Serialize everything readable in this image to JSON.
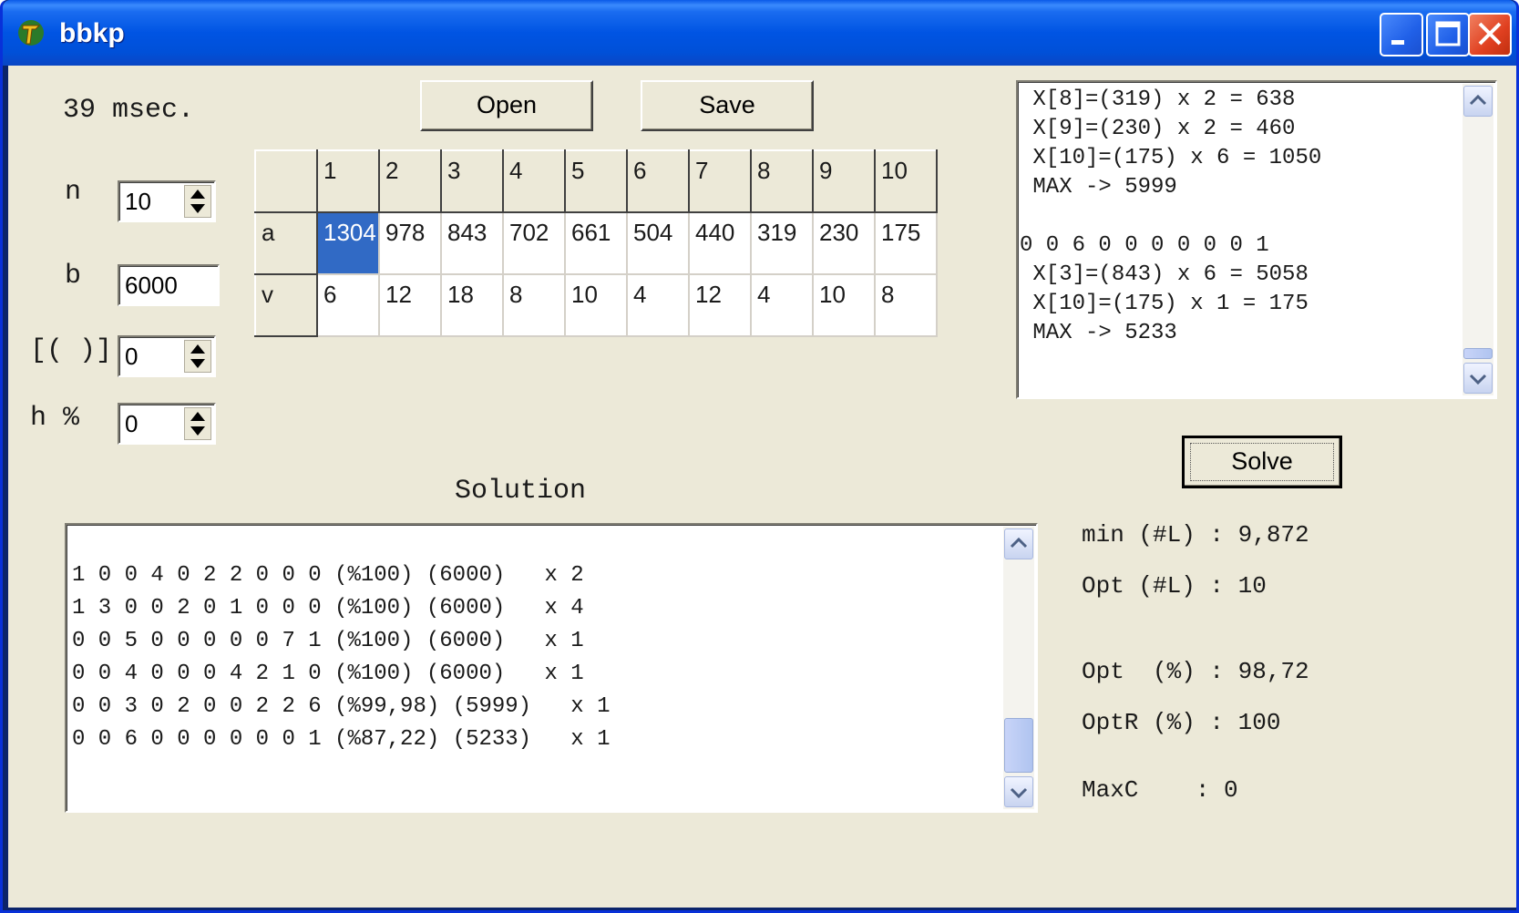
{
  "window": {
    "title": "bbkp"
  },
  "timing": "39 msec.",
  "params": {
    "n_label": "n",
    "n_value": "10",
    "b_label": "b",
    "b_value": "6000",
    "bracket_label": "[( )]",
    "bracket_value": "0",
    "h_label": "h %",
    "h_value": "0"
  },
  "toolbar": {
    "open_label": "Open",
    "save_label": "Save",
    "solve_label": "Solve"
  },
  "grid": {
    "columns": [
      "1",
      "2",
      "3",
      "4",
      "5",
      "6",
      "7",
      "8",
      "9",
      "10"
    ],
    "rows": [
      {
        "label": "a",
        "values": [
          "1304",
          "978",
          "843",
          "702",
          "661",
          "504",
          "440",
          "319",
          "230",
          "175"
        ]
      },
      {
        "label": "v",
        "values": [
          "6",
          "12",
          "18",
          "8",
          "10",
          "4",
          "12",
          "4",
          "10",
          "8"
        ]
      }
    ],
    "selected": "a-1"
  },
  "log": {
    "lines": [
      " X[8]=(319) x 2 = 638",
      " X[9]=(230) x 2 = 460",
      " X[10]=(175) x 6 = 1050",
      " MAX -> 5999",
      "",
      "0 0 6 0 0 0 0 0 0 1",
      " X[3]=(843) x 6 = 5058",
      " X[10]=(175) x 1 = 175",
      " MAX -> 5233"
    ]
  },
  "solution": {
    "heading": "Solution",
    "lines": [
      "1 0 0 4 0 2 2 0 0 0 (%100) (6000)   x 2",
      "1 3 0 0 2 0 1 0 0 0 (%100) (6000)   x 4",
      "0 0 5 0 0 0 0 0 7 1 (%100) (6000)   x 1",
      "0 0 4 0 0 0 4 2 1 0 (%100) (6000)   x 1",
      "0 0 3 0 2 0 0 2 2 6 (%99,98) (5999)   x 1",
      "0 0 6 0 0 0 0 0 0 1 (%87,22) (5233)   x 1"
    ]
  },
  "stats": {
    "min_L": "min (#L) : 9,872",
    "opt_L": "Opt (#L) : 10",
    "opt_pct": "Opt  (%) : 98,72",
    "optr_pct": "OptR (%) : 100",
    "maxc": "MaxC    : 0"
  }
}
